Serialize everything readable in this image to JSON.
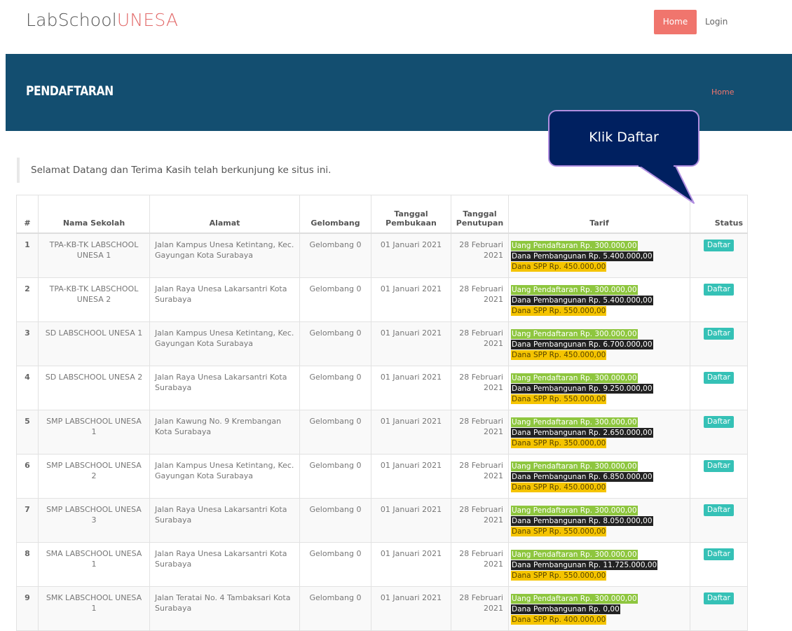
{
  "header": {
    "logo_main": "LabSchool",
    "logo_accent": "UNESA",
    "nav": {
      "home": "Home",
      "login": "Login"
    }
  },
  "banner": {
    "title": "PENDAFTARAN",
    "breadcrumb": "Home"
  },
  "welcome": "Selamat Datang dan Terima Kasih telah berkunjung ke situs ini.",
  "callout": "Klik Daftar",
  "table": {
    "columns": [
      "#",
      "Nama Sekolah",
      "Alamat",
      "Gelombang",
      "Tanggal Pembukaan",
      "Tanggal Penutupan",
      "Tarif",
      "Status"
    ],
    "rows": [
      {
        "no": "1",
        "nama": "TPA-KB-TK LABSCHOOL UNESA 1",
        "alamat": "Jalan Kampus Unesa Ketintang, Kec. Gayungan Kota Surabaya",
        "gelombang": "Gelombang 0",
        "buka": "01 Januari 2021",
        "tutup": "28 Februari 2021",
        "pendaftaran": "Uang Pendaftaran Rp. 300.000,00",
        "pembangunan": "Dana Pembangunan Rp. 5.400.000,00",
        "spp": "Dana SPP Rp. 450.000,00",
        "status": "Daftar"
      },
      {
        "no": "2",
        "nama": "TPA-KB-TK LABSCHOOL UNESA 2",
        "alamat": "Jalan Raya Unesa Lakarsantri Kota Surabaya",
        "gelombang": "Gelombang 0",
        "buka": "01 Januari 2021",
        "tutup": "28 Februari 2021",
        "pendaftaran": "Uang Pendaftaran Rp. 300.000,00",
        "pembangunan": "Dana Pembangunan Rp. 5.400.000,00",
        "spp": "Dana SPP Rp. 550.000,00",
        "status": "Daftar"
      },
      {
        "no": "3",
        "nama": "SD LABSCHOOL UNESA 1",
        "alamat": "Jalan Kampus Unesa Ketintang, Kec. Gayungan Kota Surabaya",
        "gelombang": "Gelombang 0",
        "buka": "01 Januari 2021",
        "tutup": "28 Februari 2021",
        "pendaftaran": "Uang Pendaftaran Rp. 300.000,00",
        "pembangunan": "Dana Pembangunan Rp. 6.700.000,00",
        "spp": "Dana SPP Rp. 450.000,00",
        "status": "Daftar"
      },
      {
        "no": "4",
        "nama": "SD LABSCHOOL UNESA 2",
        "alamat": "Jalan Raya Unesa Lakarsantri Kota Surabaya",
        "gelombang": "Gelombang 0",
        "buka": "01 Januari 2021",
        "tutup": "28 Februari 2021",
        "pendaftaran": "Uang Pendaftaran Rp. 300.000,00",
        "pembangunan": "Dana Pembangunan Rp. 9.250.000,00",
        "spp": "Dana SPP Rp. 550.000,00",
        "status": "Daftar"
      },
      {
        "no": "5",
        "nama": "SMP LABSCHOOL UNESA 1",
        "alamat": "Jalan Kawung No. 9 Krembangan Kota Surabaya",
        "gelombang": "Gelombang 0",
        "buka": "01 Januari 2021",
        "tutup": "28 Februari 2021",
        "pendaftaran": "Uang Pendaftaran Rp. 300.000,00",
        "pembangunan": "Dana Pembangunan Rp. 2.650.000,00",
        "spp": "Dana SPP Rp. 350.000,00",
        "status": "Daftar"
      },
      {
        "no": "6",
        "nama": "SMP LABSCHOOL UNESA 2",
        "alamat": "Jalan Kampus Unesa Ketintang, Kec. Gayungan Kota Surabaya",
        "gelombang": "Gelombang 0",
        "buka": "01 Januari 2021",
        "tutup": "28 Februari 2021",
        "pendaftaran": "Uang Pendaftaran Rp. 300.000,00",
        "pembangunan": "Dana Pembangunan Rp. 6.850.000,00",
        "spp": "Dana SPP Rp. 450.000,00",
        "status": "Daftar"
      },
      {
        "no": "7",
        "nama": "SMP LABSCHOOL UNESA 3",
        "alamat": "Jalan Raya Unesa Lakarsantri Kota Surabaya",
        "gelombang": "Gelombang 0",
        "buka": "01 Januari 2021",
        "tutup": "28 Februari 2021",
        "pendaftaran": "Uang Pendaftaran Rp. 300.000,00",
        "pembangunan": "Dana Pembangunan Rp. 8.050.000,00",
        "spp": "Dana SPP Rp. 550.000,00",
        "status": "Daftar"
      },
      {
        "no": "8",
        "nama": "SMA LABSCHOOL UNESA 1",
        "alamat": "Jalan Raya Unesa Lakarsantri Kota Surabaya",
        "gelombang": "Gelombang 0",
        "buka": "01 Januari 2021",
        "tutup": "28 Februari 2021",
        "pendaftaran": "Uang Pendaftaran Rp. 300.000,00",
        "pembangunan": "Dana Pembangunan Rp. 11.725.000,00",
        "spp": "Dana SPP Rp. 550.000,00",
        "status": "Daftar"
      },
      {
        "no": "9",
        "nama": "SMK LABSCHOOL UNESA 1",
        "alamat": "Jalan Teratai No. 4 Tambaksari Kota Surabaya",
        "gelombang": "Gelombang 0",
        "buka": "01 Januari 2021",
        "tutup": "28 Februari 2021",
        "pendaftaran": "Uang Pendaftaran Rp. 300.000,00",
        "pembangunan": "Dana Pembangunan Rp. 0,00",
        "spp": "Dana SPP Rp. 400.000,00",
        "status": "Daftar"
      }
    ]
  },
  "colors": {
    "accent": "#f0756d",
    "banner": "#134e70",
    "tag_pendaftaran": "#8ec63f",
    "tag_pembangunan": "#222222",
    "tag_spp": "#f5c400",
    "status_button": "#35c1b6",
    "callout_fill": "#002060",
    "callout_border": "#b18ee0"
  }
}
